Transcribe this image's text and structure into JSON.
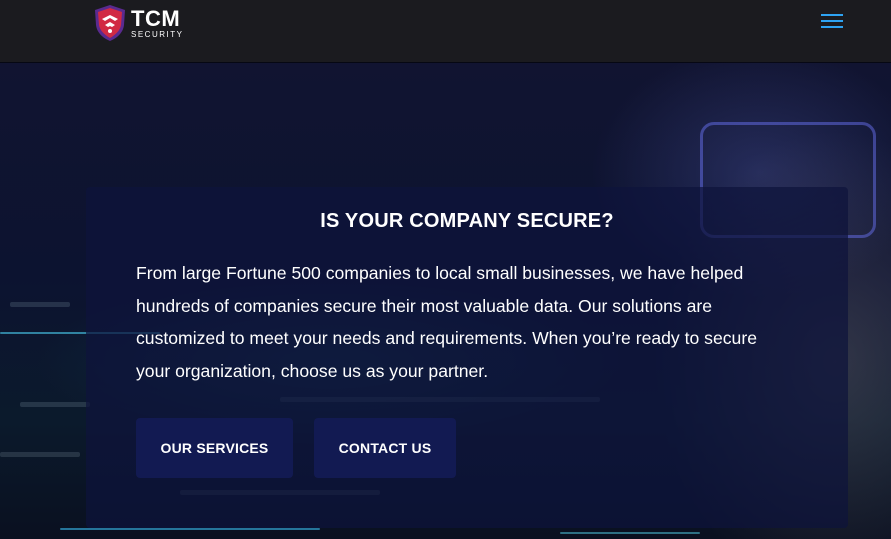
{
  "header": {
    "logo": {
      "main": "TCM",
      "sub": "SECURITY",
      "icon": "shield-icon"
    },
    "menu_icon": "hamburger-icon",
    "colors": {
      "background": "#1b1b1f",
      "menu": "#2ea3f2",
      "shield_red": "#d12a44",
      "shield_purple": "#5a2a8f"
    }
  },
  "hero": {
    "title": "IS YOUR COMPANY SECURE?",
    "body": "From large Fortune 500 companies to local small businesses, we have helped hundreds of companies secure their most valuable data. Our solutions are customized to meet your needs and requirements. When you’re ready to secure your organization, choose us as your partner.",
    "buttons": {
      "services": "OUR SERVICES",
      "contact": "CONTACT US"
    },
    "colors": {
      "card": "#0e143c",
      "button": "#121a52",
      "text": "#ffffff"
    }
  }
}
